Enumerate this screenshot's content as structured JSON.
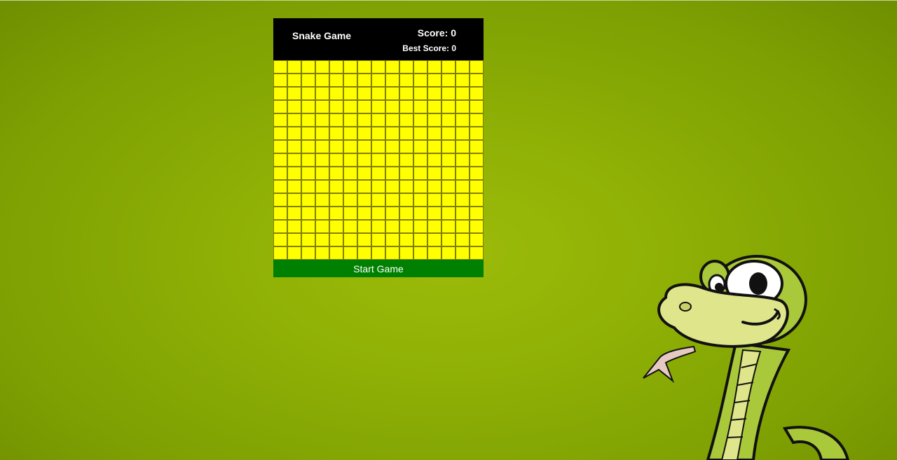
{
  "header": {
    "title": "Snake Game",
    "score_label": "Score: 0",
    "best_score_label": "Best Score: 0"
  },
  "game": {
    "score": 0,
    "best_score": 0,
    "grid_columns": 15,
    "grid_rows": 15,
    "cell_color": "#ffff00"
  },
  "controls": {
    "start_label": "Start Game",
    "start_color": "#008000"
  },
  "colors": {
    "background": "#8fb005",
    "header_background": "#000000"
  },
  "decoration": {
    "mascot_icon": "snake-mascot-icon"
  }
}
